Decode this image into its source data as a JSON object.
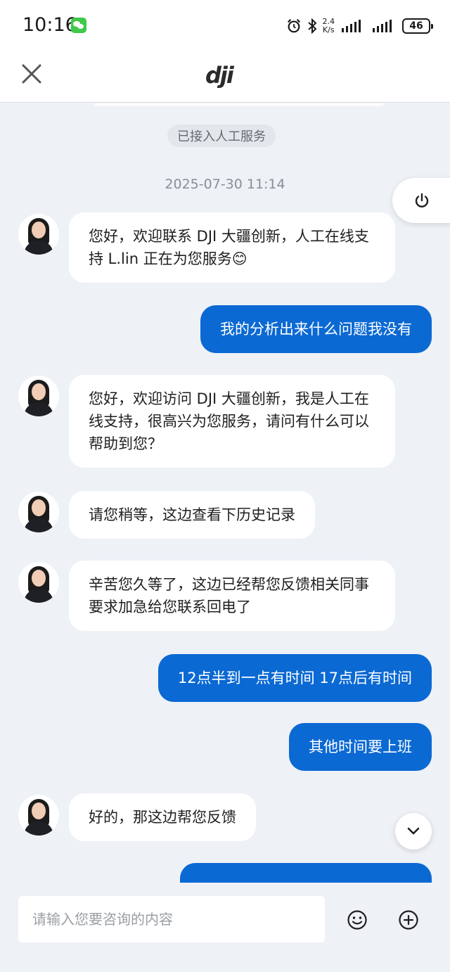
{
  "status_bar": {
    "time": "10:16",
    "net_speed_value": "2.4",
    "net_speed_unit": "K/s",
    "battery": "46"
  },
  "header": {
    "brand": "dji"
  },
  "chat": {
    "system_notice": "已接入人工服务",
    "timestamp": "2025-07-30 11:14",
    "messages": [
      {
        "from": "agent",
        "text": "您好，欢迎联系 DJI 大疆创新，人工在线支持 L.lin 正在为您服务😊"
      },
      {
        "from": "user",
        "text": "我的分析出来什么问题我没有"
      },
      {
        "from": "agent",
        "text": "您好，欢迎访问 DJI 大疆创新，我是人工在线支持，很高兴为您服务，请问有什么可以帮助到您？"
      },
      {
        "from": "agent",
        "text": "请您稍等，这边查看下历史记录"
      },
      {
        "from": "agent",
        "text": "辛苦您久等了，这边已经帮您反馈相关同事要求加急给您联系回电了"
      },
      {
        "from": "user",
        "text": "12点半到一点有时间 17点后有时间"
      },
      {
        "from": "user",
        "text": "其他时间要上班"
      },
      {
        "from": "agent",
        "text": "好的，那这边帮您反馈"
      }
    ]
  },
  "composer": {
    "placeholder": "请输入您要咨询的内容"
  },
  "colors": {
    "user_bubble": "#0b69d3",
    "background": "#eef1f6"
  }
}
